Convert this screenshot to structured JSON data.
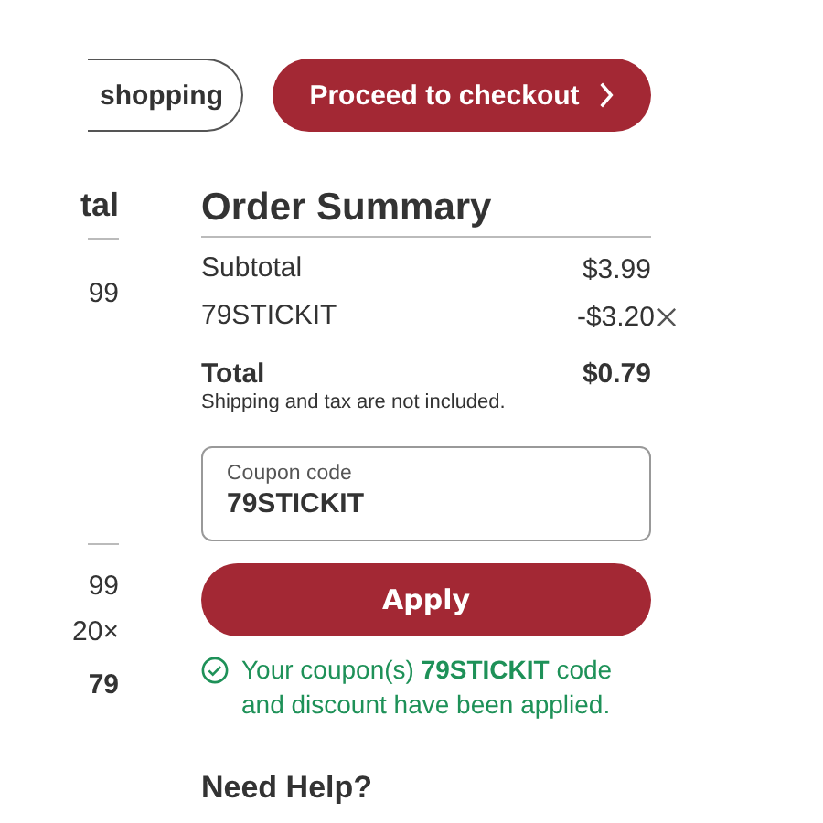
{
  "buttons": [
    {
      "label": "shopping",
      "kind": "outline"
    },
    {
      "label": "Proceed to checkout",
      "kind": "primary"
    }
  ],
  "background_column": [
    {
      "text": "tal",
      "kind": "heading"
    },
    {
      "text": "99",
      "kind": "value"
    },
    {
      "text": "99",
      "kind": "value"
    },
    {
      "text": "20×",
      "kind": "value"
    },
    {
      "text": "79",
      "kind": "total"
    }
  ],
  "order_summary": {
    "title": "Order Summary",
    "lines": [
      {
        "label": "Subtotal",
        "amount": "$3.99",
        "removable": false
      },
      {
        "label": "79STICKIT",
        "amount": "-$3.20",
        "removable": true
      }
    ],
    "total": {
      "label": "Total",
      "amount": "$0.79"
    },
    "note": "Shipping and tax are not included.",
    "coupon": {
      "label": "Coupon code",
      "value": "79STICKIT"
    },
    "apply_button": "Apply",
    "message": "Your coupon(s) **79STICKIT** code and discount have been applied.",
    "help_title": "Need Help?"
  }
}
